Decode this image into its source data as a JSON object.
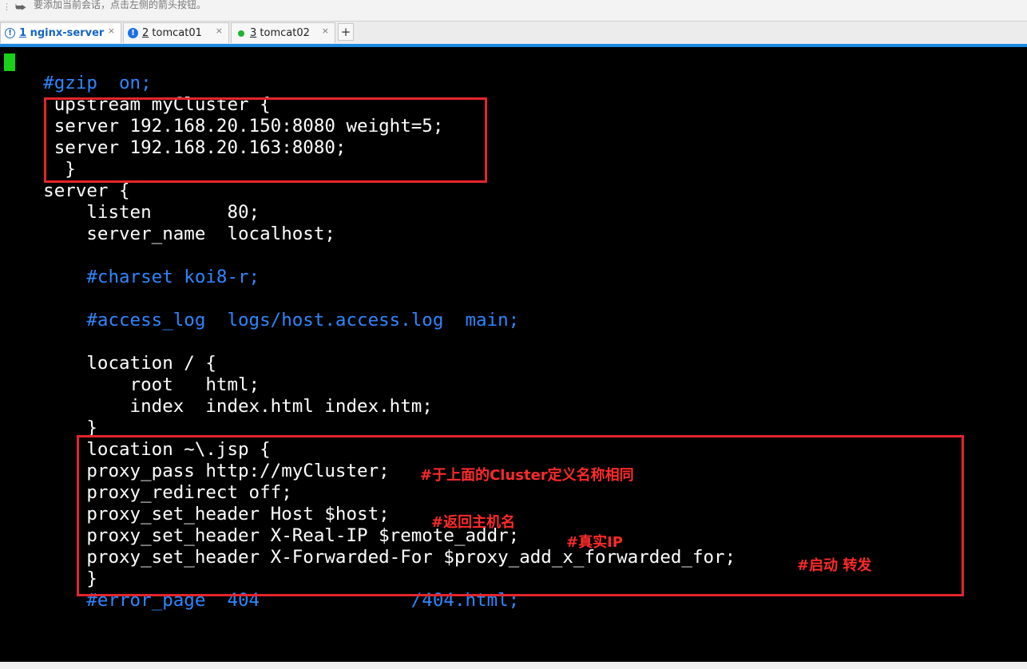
{
  "toolbar": {
    "hint": "要添加当前会话，点击左侧的箭头按钮。"
  },
  "tabs": [
    {
      "num": "1",
      "name": " nginx-server",
      "close": "×",
      "status": "info"
    },
    {
      "num": "2",
      "name": " tomcat01",
      "close": "×",
      "status": "info"
    },
    {
      "num": "3",
      "name": " tomcat02",
      "close": "×",
      "status": "connected"
    }
  ],
  "add_tab_label": "+",
  "terminal": {
    "lines": [
      "    #gzip  on;",
      "     upstream myCluster {",
      "     server 192.168.20.150:8080 weight=5;",
      "     server 192.168.20.163:8080;",
      "      }",
      "    server {",
      "        listen       80;",
      "        server_name  localhost;",
      "",
      "        #charset koi8-r;",
      "",
      "        #access_log  logs/host.access.log  main;",
      "",
      "        location / {",
      "            root   html;",
      "            index  index.html index.htm;",
      "        }",
      "        location ~\\.jsp {",
      "        proxy_pass http://myCluster;",
      "        proxy_redirect off;",
      "        proxy_set_header Host $host;",
      "        proxy_set_header X-Real-IP $remote_addr;",
      "        proxy_set_header X-Forwarded-For $proxy_add_x_forwarded_for;",
      "        }",
      "        #error_page  404              /404.html;"
    ]
  },
  "annotations": {
    "cluster": "#于上面的Cluster定义名称相同",
    "host": "#返回主机名",
    "real_ip": "#真实IP",
    "forward": "#启动 转发"
  },
  "colors": {
    "comment": "#2f86ff",
    "annotation": "#ff2a2a",
    "box": "#e4252b",
    "cursor": "#18d018"
  }
}
